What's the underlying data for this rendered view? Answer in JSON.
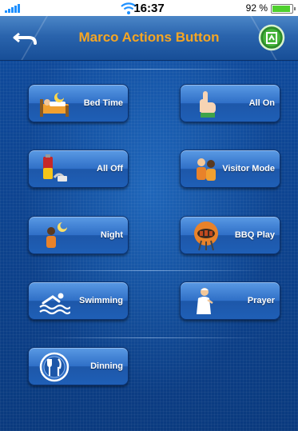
{
  "status_bar": {
    "time": "16:37",
    "battery": "92 %"
  },
  "nav": {
    "title": "Marco Actions Button"
  },
  "buttons": [
    {
      "label": "Bed Time",
      "icon": "bed-icon"
    },
    {
      "label": "All On",
      "icon": "hand-touch-icon"
    },
    {
      "label": "All Off",
      "icon": "battery-plug-icon"
    },
    {
      "label": "Visitor Mode",
      "icon": "visitor-icon"
    },
    {
      "label": "Night",
      "icon": "night-moon-icon"
    },
    {
      "label": "BBQ Play",
      "icon": "bbq-grill-icon"
    },
    {
      "label": "Swimming",
      "icon": "swimmer-icon"
    },
    {
      "label": "Prayer",
      "icon": "prayer-icon"
    },
    {
      "label": "Dinning",
      "icon": "fork-knife-icon"
    }
  ]
}
